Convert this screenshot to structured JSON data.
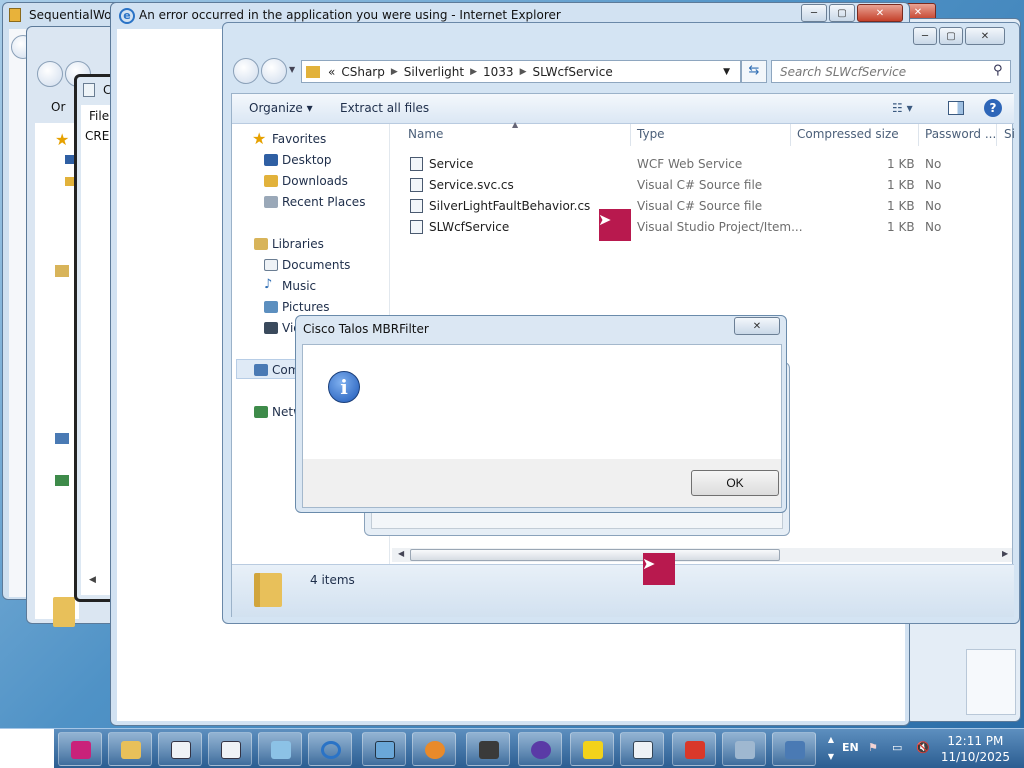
{
  "windows": {
    "back1_title": "SequentialWor",
    "ie_title": "An error occurred in the application you were using - Internet Explorer",
    "mid_stub": "C",
    "mid_menu_file": "File",
    "mid_text": "CRE",
    "back_org": "Or"
  },
  "explorer": {
    "breadcrumb": [
      "CSharp",
      "Silverlight",
      "1033",
      "SLWcfService"
    ],
    "breadcrumb_prefix": "«",
    "search_placeholder": "Search SLWcfService",
    "toolbar": {
      "organize": "Organize",
      "extract": "Extract all files"
    },
    "nav": {
      "favorites": "Favorites",
      "desktop": "Desktop",
      "downloads": "Downloads",
      "recent": "Recent Places",
      "libraries": "Libraries",
      "documents": "Documents",
      "music": "Music",
      "pictures": "Pictures",
      "videos": "Vid",
      "computer": "Com",
      "network": "Netw"
    },
    "columns": {
      "name": "Name",
      "type": "Type",
      "compressed": "Compressed size",
      "password": "Password ...",
      "size": "Si"
    },
    "files": [
      {
        "name": "Service",
        "type": "WCF Web Service",
        "compressed": "1 KB",
        "password": "No"
      },
      {
        "name": "Service.svc.cs",
        "type": "Visual C# Source file",
        "compressed": "1 KB",
        "password": "No"
      },
      {
        "name": "SilverLightFaultBehavior.cs",
        "type": "Visual C# Source file",
        "compressed": "1 KB",
        "password": "No"
      },
      {
        "name": "SLWcfService",
        "type": "Visual Studio Project/Item...",
        "compressed": "1 KB",
        "password": "No"
      }
    ],
    "status": "4 items"
  },
  "dialog": {
    "title": "Cisco Talos MBRFilter",
    "message": "",
    "ok": "OK"
  },
  "taskbar": {
    "time": "12:11 PM",
    "date": "11/10/2025",
    "lang": "EN"
  },
  "colors": {
    "accent": "#b8194e",
    "taskbar": "#2b5d91"
  }
}
